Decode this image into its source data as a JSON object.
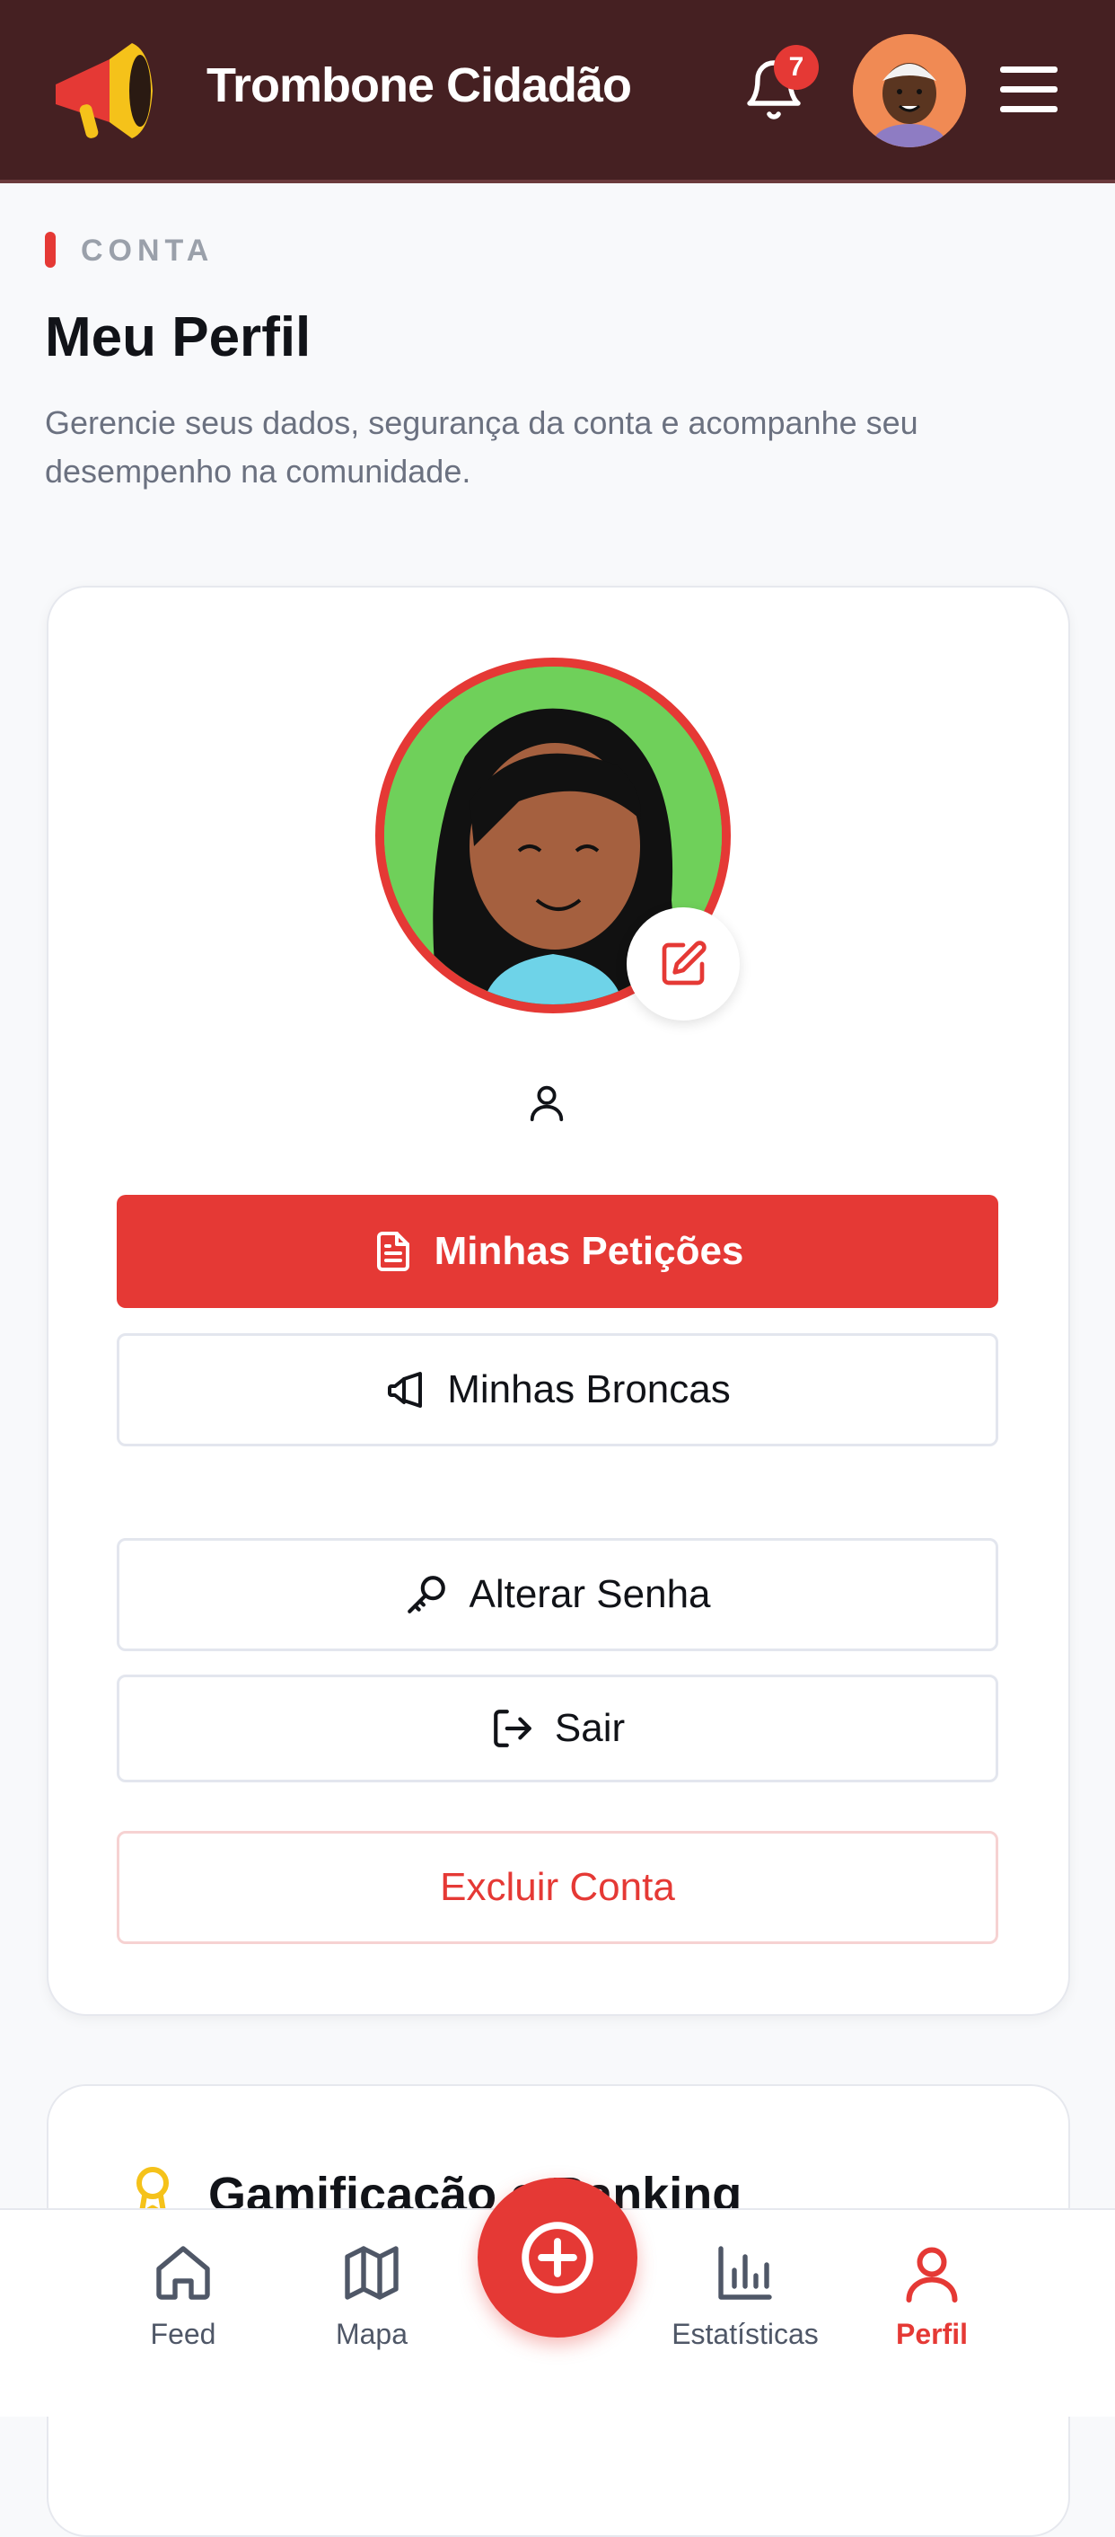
{
  "app": {
    "title": "Trombone Cidadão",
    "notification_count": "7",
    "icons": [
      "megaphone-logo",
      "bell-icon",
      "avatar",
      "menu-icon"
    ]
  },
  "page": {
    "section_label": "CONTA",
    "title": "Meu Perfil",
    "description": "Gerencie seus dados, segurança da conta e acompanhe seu desempenho na comunidade."
  },
  "profile": {
    "buttons": {
      "peticoes": "Minhas Petições",
      "broncas": "Minhas Broncas",
      "senha": "Alterar Senha",
      "sair": "Sair",
      "excluir": "Excluir Conta"
    }
  },
  "gamification": {
    "title": "Gamificação e Ranking"
  },
  "nav": {
    "items": [
      {
        "label": "Feed"
      },
      {
        "label": "Mapa"
      },
      {
        "label": "Estatísticas"
      },
      {
        "label": "Perfil"
      }
    ],
    "active": "Perfil"
  },
  "colors": {
    "header_bg": "#452022",
    "accent": "#e53935",
    "page_bg": "#f8f9fb"
  }
}
